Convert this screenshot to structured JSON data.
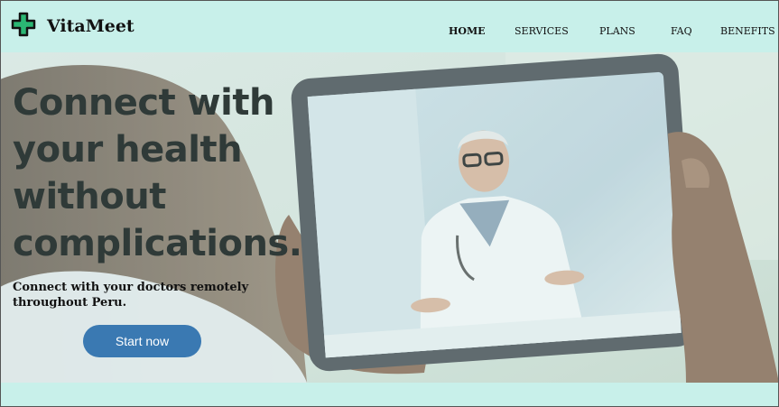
{
  "brand": {
    "name": "VitaMeet",
    "icon": "medical-cross-icon",
    "icon_color": "#2bb673"
  },
  "nav": {
    "items": [
      {
        "label": "HOME",
        "active": true
      },
      {
        "label": "SERVICES",
        "active": false
      },
      {
        "label": "PLANS",
        "active": false
      },
      {
        "label": "FAQ",
        "active": false
      },
      {
        "label": "BENEFITS",
        "active": false
      }
    ]
  },
  "hero": {
    "headline_lines": [
      "Connect with",
      "your health",
      "without",
      "complications."
    ],
    "subheadline": "Connect with your doctors remotely throughout Peru.",
    "cta_label": "Start now",
    "image": "patient-holding-tablet-video-call-with-doctor"
  },
  "colors": {
    "background": "#c8f0ea",
    "cta": "#3a79b2",
    "headline": "#2f3a38"
  }
}
